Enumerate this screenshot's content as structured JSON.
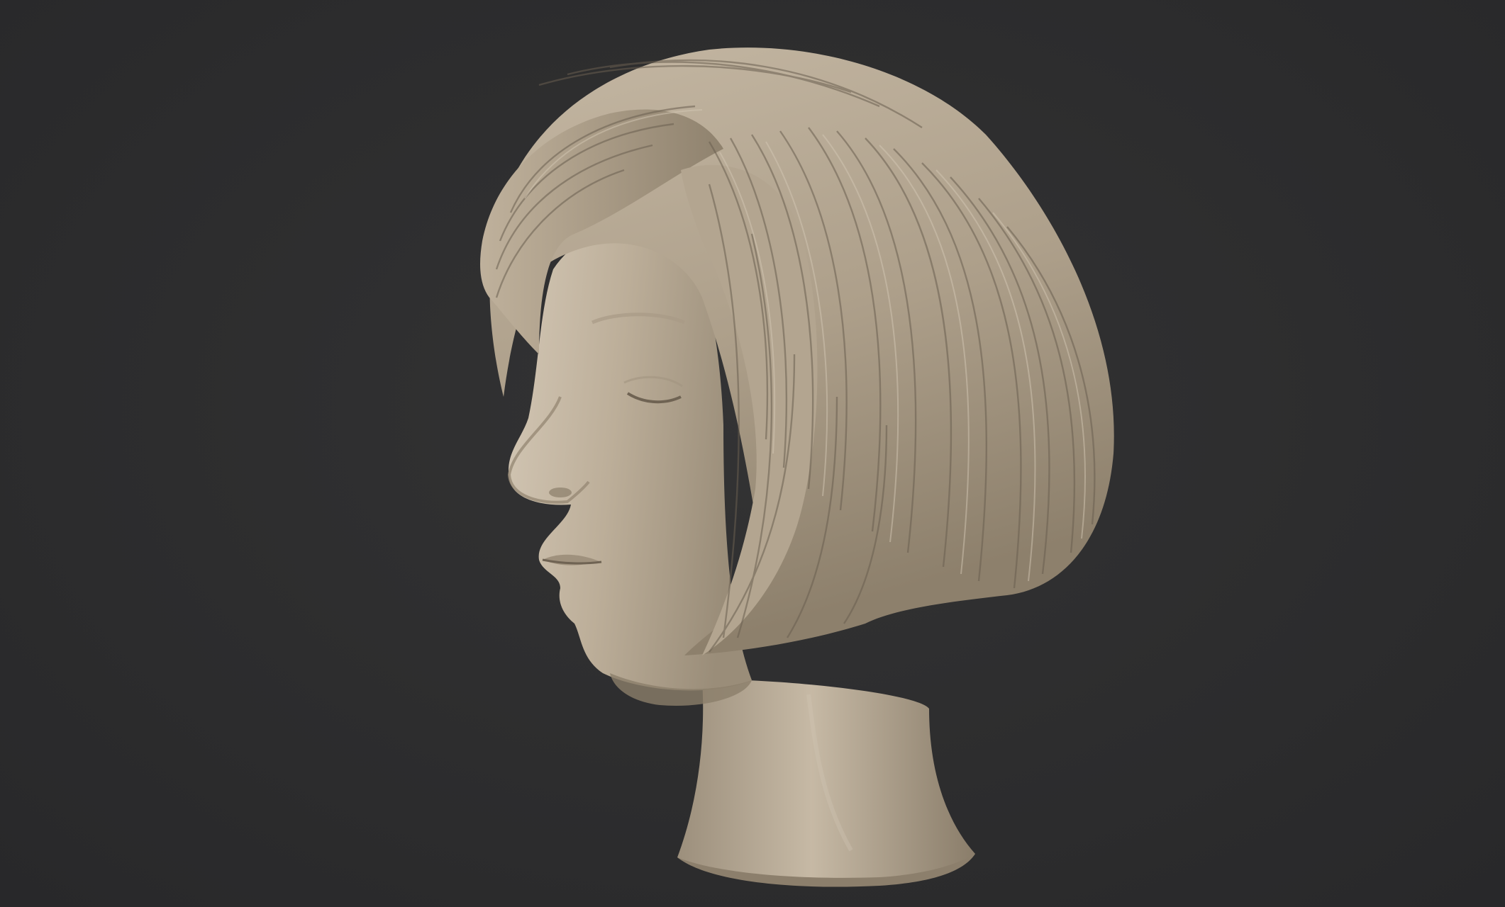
{
  "viewport": {
    "background_color": "#2e2e2f",
    "subject": "sculpted-head-bob-hair"
  },
  "model": {
    "clay_color": "#b3a592",
    "clay_light": "#d2c6b4",
    "clay_shadow": "#7d7160",
    "hair_line_color": "#5e5446"
  }
}
